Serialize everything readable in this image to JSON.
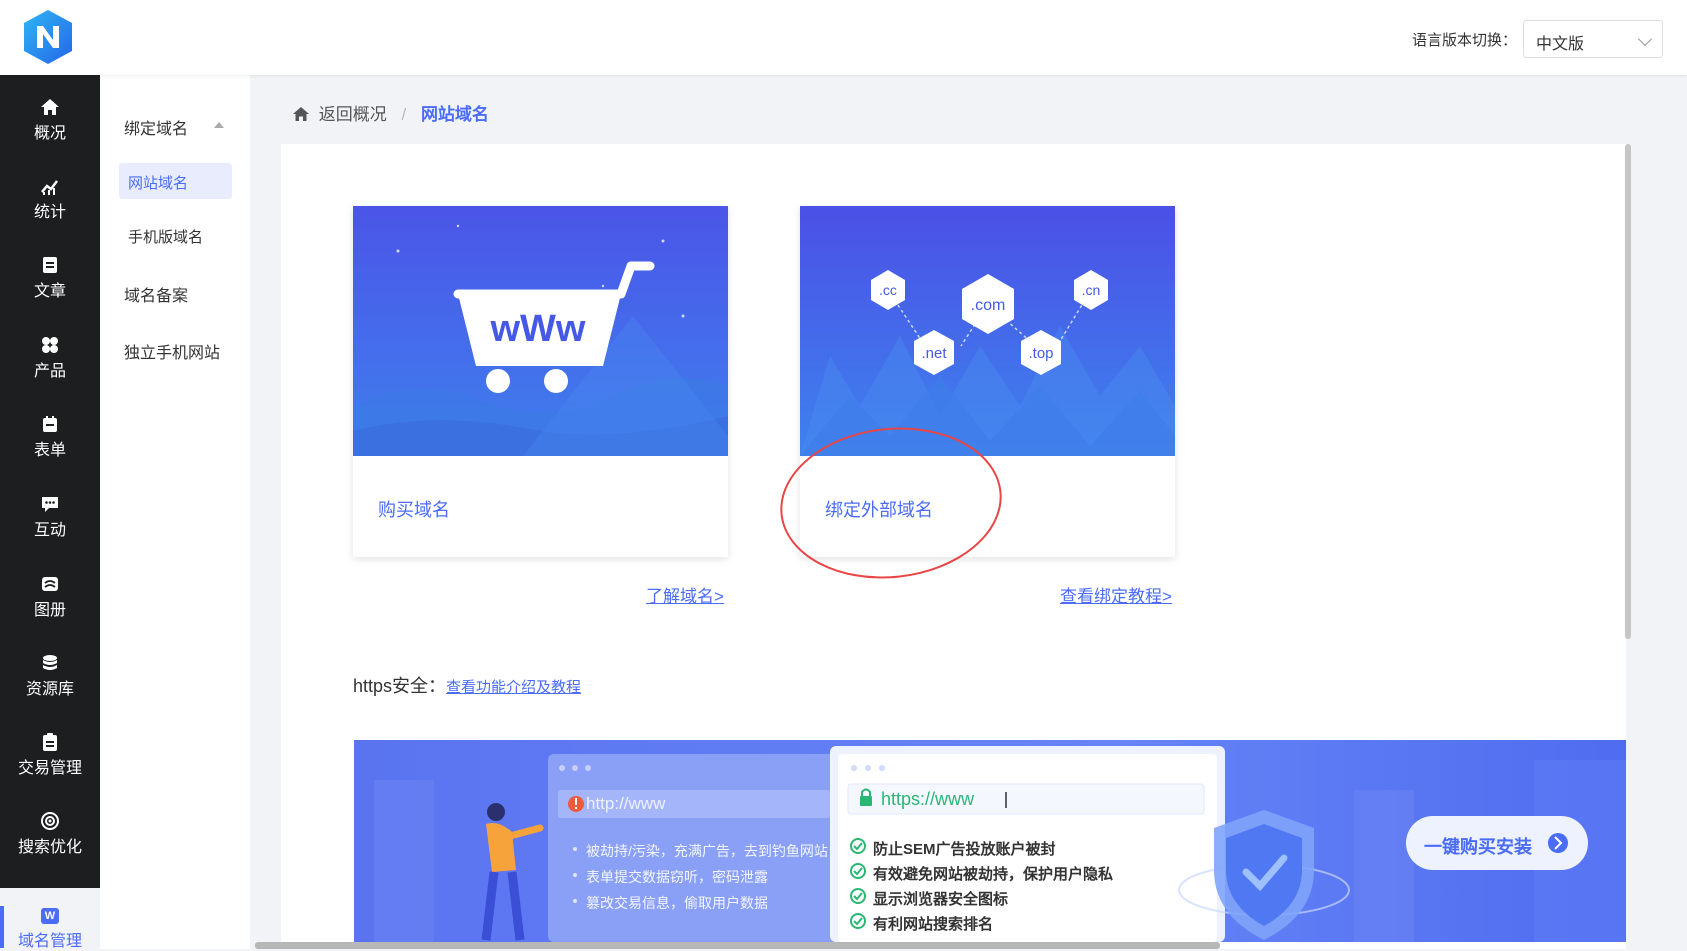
{
  "header": {
    "lang_label": "语言版本切换：",
    "lang_value": "中文版"
  },
  "sidebar": {
    "items": [
      {
        "label": "概况",
        "icon": "home-icon"
      },
      {
        "label": "统计",
        "icon": "chart-icon"
      },
      {
        "label": "文章",
        "icon": "document-icon"
      },
      {
        "label": "产品",
        "icon": "grid-icon"
      },
      {
        "label": "表单",
        "icon": "form-icon"
      },
      {
        "label": "互动",
        "icon": "chat-icon"
      },
      {
        "label": "图册",
        "icon": "gallery-icon"
      },
      {
        "label": "资源库",
        "icon": "database-icon"
      },
      {
        "label": "交易管理",
        "icon": "clipboard-icon"
      },
      {
        "label": "搜索优化",
        "icon": "target-icon"
      }
    ],
    "active": {
      "label": "域名管理",
      "icon_text": "W"
    }
  },
  "subnav": {
    "group": "绑定域名",
    "items": [
      "网站域名",
      "手机版域名"
    ],
    "others": [
      "域名备案",
      "独立手机网站"
    ]
  },
  "breadcrumb": {
    "back": "返回概况",
    "sep": "/",
    "current": "网站域名"
  },
  "cards": [
    {
      "title": "购买域名",
      "link": "了解域名>"
    },
    {
      "title": "绑定外部域名",
      "link": "查看绑定教程>"
    }
  ],
  "card_art": {
    "www": "wWw",
    "tlds": [
      ".cc",
      ".com",
      ".cn",
      ".net",
      ".top"
    ]
  },
  "https": {
    "label": "https安全：",
    "link": "查看功能介绍及教程"
  },
  "banner": {
    "bad_url": "http://www",
    "bad_items": [
      "被劫持/污染，充满广告，去到钓鱼网站",
      "表单提交数据窃听，密码泄露",
      "篡改交易信息，偷取用户数据"
    ],
    "good_url": "https://www",
    "good_items": [
      "防止SEM广告投放账户被封",
      "有效避免网站被劫持，保护用户隐私",
      "显示浏览器安全图标",
      "有利网站搜索排名"
    ],
    "cta": "一键购买安装"
  },
  "colors": {
    "accent": "#4a6cf7",
    "sidebar_bg": "#1d1e20",
    "highlight_circle": "#e84545"
  }
}
